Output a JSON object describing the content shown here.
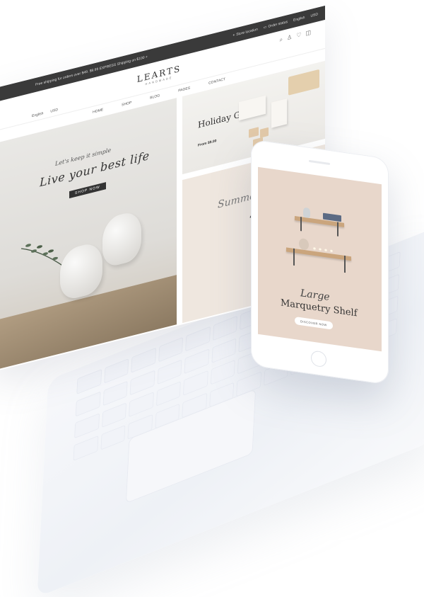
{
  "laptop": {
    "promo_text": "Free shipping for orders over $49. $9.99 EXPRESS Shipping on $100 +",
    "store_locator": "Store location",
    "order_status": "Order status",
    "language_top": "English",
    "currency_top": "USD",
    "logo": {
      "brand": "LEARTS",
      "sub": "HANDMADE"
    },
    "language": "English",
    "currency": "USD",
    "nav": [
      "HOME",
      "SHOP",
      "BLOG",
      "PAGES",
      "CONTACT"
    ],
    "hero": {
      "small_text": "Let's keep it simple",
      "big_text": "Live your best life",
      "button": "SHOP NOW"
    },
    "gifts": {
      "title": "Holiday Gifts",
      "price": "From $9.00"
    },
    "summer": {
      "script": "Summer Sale",
      "number": "40"
    }
  },
  "phone": {
    "script": "Large",
    "title": "Marquetry Shelf",
    "button": "DISCOVER NOW"
  }
}
